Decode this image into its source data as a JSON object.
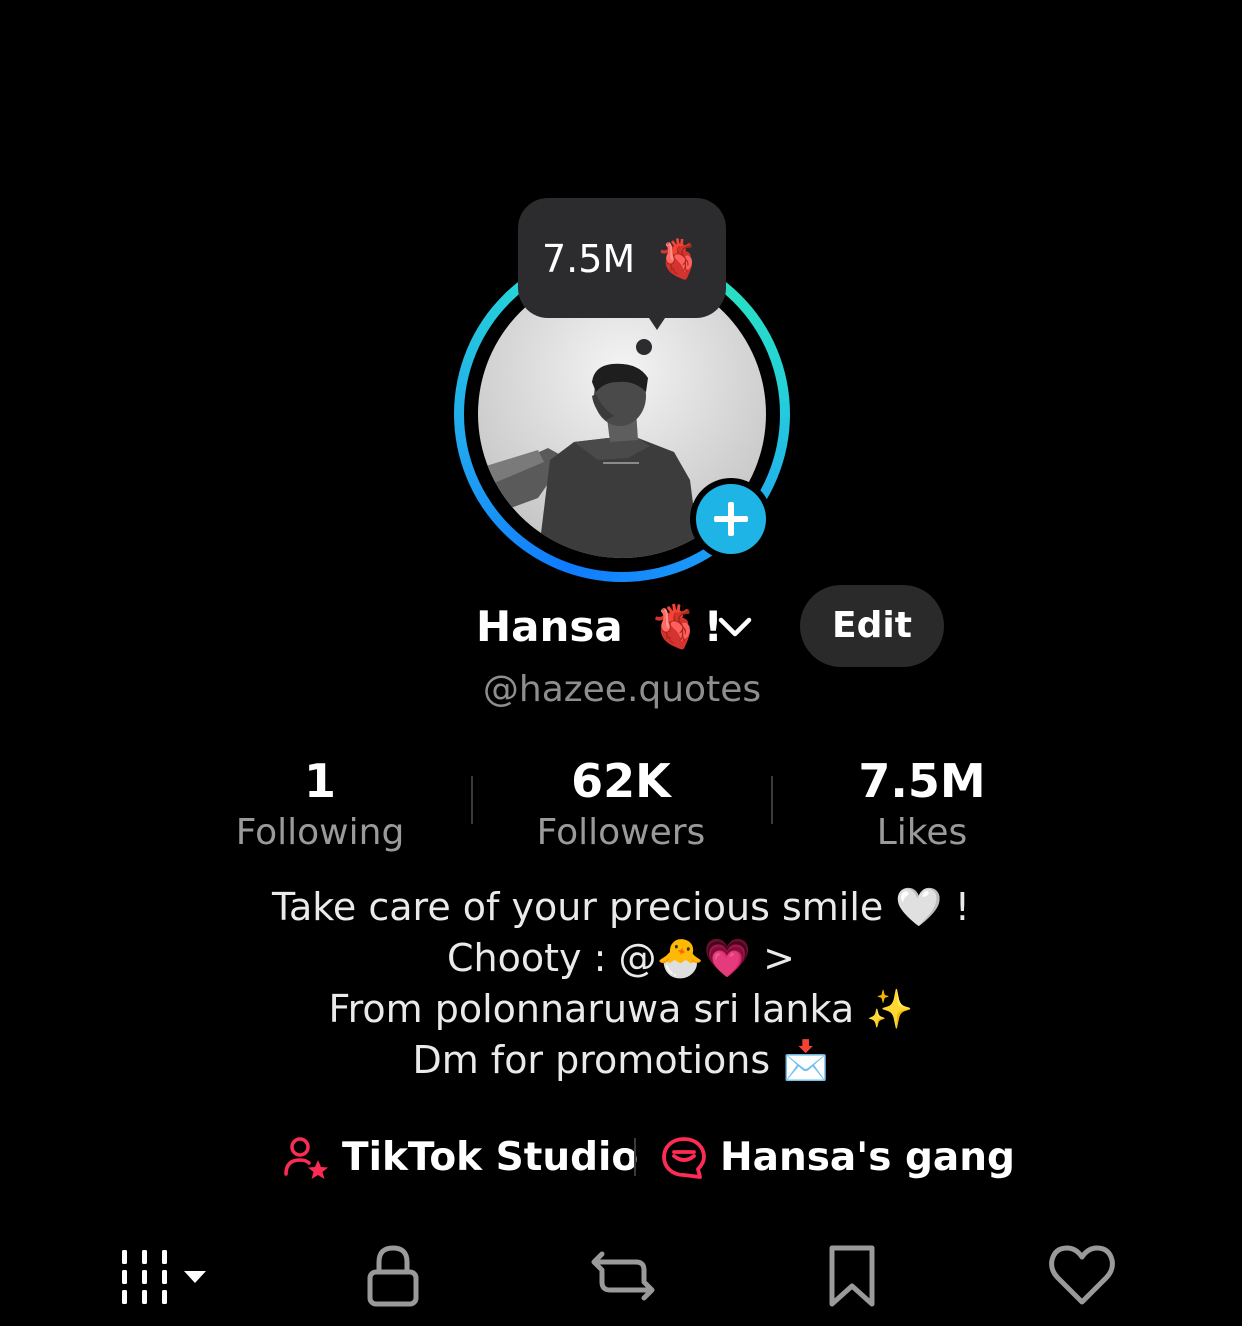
{
  "tooltip": {
    "text": "7.5M",
    "emoji": "🫀"
  },
  "profile": {
    "name": "Hansa",
    "name_emoji": "🫀",
    "name_suffix": "!",
    "handle": "@hazee.quotes",
    "edit_label": "Edit",
    "accent_ring_colors": [
      "#0f7bff",
      "#2be6b8"
    ],
    "plus_badge_color": "#1fb4e6"
  },
  "stats": [
    {
      "value": "1",
      "label": "Following"
    },
    {
      "value": "62K",
      "label": "Followers"
    },
    {
      "value": "7.5M",
      "label": "Likes"
    }
  ],
  "bio": {
    "lines": [
      "Take care of your precious smile 🤍 !",
      "Chooty : @🐣💗  >",
      "From polonnaruwa sri lanka ✨",
      "Dm for promotions 📩"
    ]
  },
  "links": {
    "studio_label": "TikTok Studio",
    "gang_label": "Hansa's gang",
    "accent_color": "#fe2c55"
  },
  "tabs": {
    "icons": [
      "grid-icon",
      "lock-icon",
      "repost-icon",
      "bookmark-icon",
      "heart-icon"
    ]
  }
}
